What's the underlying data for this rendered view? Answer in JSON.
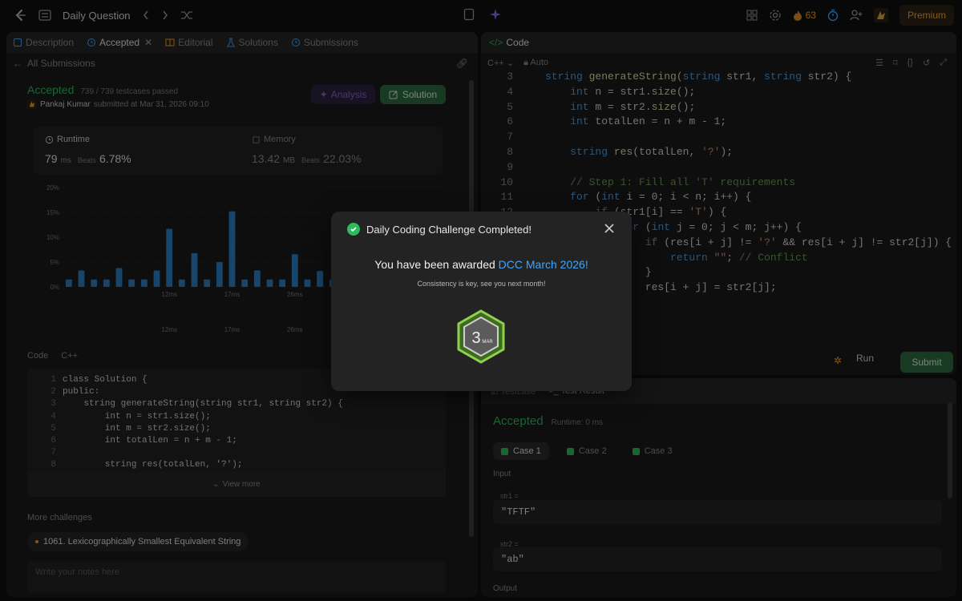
{
  "topbar": {
    "title": "Daily Question",
    "streak": "63",
    "premium": "Premium"
  },
  "left": {
    "tabs": [
      "Description",
      "Accepted",
      "Editorial",
      "Solutions",
      "Submissions"
    ],
    "back_label": "All Submissions",
    "status": "Accepted",
    "testcases": "739 / 739 testcases passed",
    "author": "Pankaj Kumar",
    "submitted_text": "submitted at Mar 31, 2026 09:10",
    "analysis_label": "Analysis",
    "solution_label": "Solution",
    "runtime": {
      "label": "Runtime",
      "value": "79",
      "unit": "ms",
      "beats_label": "Beats",
      "beats": "6.78%"
    },
    "memory": {
      "label": "Memory",
      "value": "13.42",
      "unit": "MB",
      "beats_label": "Beats",
      "beats": "22.03%"
    },
    "code_label": "Code",
    "lang": "C++",
    "code_lines": [
      "class Solution {",
      "public:",
      "    string generateString(string str1, string str2) {",
      "        int n = str1.size();",
      "        int m = str2.size();",
      "        int totalLen = n + m - 1;",
      "",
      "        string res(totalLen, '?');"
    ],
    "view_more": "View more",
    "more_challenges": "More challenges",
    "challenge_item": "1061. Lexicographically Smallest Equivalent String",
    "notes_placeholder": "Write your notes here"
  },
  "chart_data": {
    "type": "bar",
    "yticks": [
      "20%",
      "15%",
      "10%",
      "5%",
      "0%"
    ],
    "ylim": [
      0,
      20
    ],
    "xticks": [
      "12ms",
      "17ms",
      "26ms"
    ],
    "values": [
      1.5,
      3.3,
      1.5,
      1.5,
      3.8,
      1.5,
      1.5,
      3.3,
      11.7,
      1.5,
      6.8,
      1.5,
      5.0,
      15.2,
      1.5,
      3.3,
      1.5,
      1.5,
      6.6,
      1.5,
      3.2,
      1.5,
      1.5,
      3.3,
      1.5,
      1.5,
      1.5,
      1.5,
      1.5,
      1.5
    ],
    "highlight_index": 22,
    "mini_xticks": [
      "12ms",
      "17ms",
      "26ms"
    ]
  },
  "code": {
    "tab_label": "Code",
    "lang": "C++",
    "auto": "Auto",
    "start_line": 3,
    "lines": [
      [
        {
          "t": "string ",
          "c": "kw"
        },
        {
          "t": "generateString",
          "c": "fn"
        },
        {
          "t": "(",
          "c": ""
        },
        {
          "t": "string",
          "c": "kw"
        },
        {
          "t": " str1, ",
          "c": ""
        },
        {
          "t": "string",
          "c": "kw"
        },
        {
          "t": " str2) {",
          "c": ""
        }
      ],
      [
        {
          "t": "    int",
          "c": "kw"
        },
        {
          "t": " n = str1.",
          "c": ""
        },
        {
          "t": "size",
          "c": "fn"
        },
        {
          "t": "();",
          "c": ""
        }
      ],
      [
        {
          "t": "    int",
          "c": "kw"
        },
        {
          "t": " m = str2.",
          "c": ""
        },
        {
          "t": "size",
          "c": "fn"
        },
        {
          "t": "();",
          "c": ""
        }
      ],
      [
        {
          "t": "    int",
          "c": "kw"
        },
        {
          "t": " totalLen = n + m - 1;",
          "c": ""
        }
      ],
      [],
      [
        {
          "t": "    string ",
          "c": "kw"
        },
        {
          "t": "res",
          "c": "fn"
        },
        {
          "t": "(totalLen, ",
          "c": ""
        },
        {
          "t": "'?'",
          "c": "str"
        },
        {
          "t": ");",
          "c": ""
        }
      ],
      [],
      [
        {
          "t": "    // Step 1: Fill all 'T' requirements",
          "c": "cm"
        }
      ],
      [
        {
          "t": "    for",
          "c": "kw"
        },
        {
          "t": " (",
          "c": ""
        },
        {
          "t": "int",
          "c": "kw"
        },
        {
          "t": " i = 0; i < n; i++) {",
          "c": ""
        }
      ],
      [
        {
          "t": "        if",
          "c": "kw"
        },
        {
          "t": " (str1[i] == ",
          "c": ""
        },
        {
          "t": "'T'",
          "c": "str"
        },
        {
          "t": ") {",
          "c": ""
        }
      ],
      [
        {
          "t": "            for",
          "c": "kw"
        },
        {
          "t": " (",
          "c": ""
        },
        {
          "t": "int",
          "c": "kw"
        },
        {
          "t": " j = 0; j < m; j++) {",
          "c": ""
        }
      ],
      [
        {
          "t": "                if",
          "c": "kw"
        },
        {
          "t": " (res[i + j] != ",
          "c": ""
        },
        {
          "t": "'?'",
          "c": "str"
        },
        {
          "t": " && res[i + j] != str2[j]) {",
          "c": ""
        }
      ],
      [
        {
          "t": "                    return",
          "c": "kw"
        },
        {
          "t": " ",
          "c": ""
        },
        {
          "t": "\"\"",
          "c": "str"
        },
        {
          "t": "; ",
          "c": ""
        },
        {
          "t": "// Conflict",
          "c": "cm"
        }
      ],
      [
        {
          "t": "                }",
          "c": ""
        }
      ],
      [
        {
          "t": "                res[i + j] = str2[j];",
          "c": ""
        }
      ]
    ],
    "run": "Run",
    "submit": "Submit"
  },
  "result": {
    "tabs": [
      "Testcase",
      "Test Result"
    ],
    "status": "Accepted",
    "runtime": "Runtime: 0 ms",
    "cases": [
      "Case 1",
      "Case 2",
      "Case 3"
    ],
    "input_label": "Input",
    "var1": "str1 =",
    "val1": "\"TFTF\"",
    "var2": "str2 =",
    "val2": "\"ab\"",
    "output_label": "Output"
  },
  "modal": {
    "title": "Daily Coding Challenge Completed!",
    "msg_prefix": "You have been awarded",
    "msg_link": "DCC March 2026!",
    "sub": "Consistency is key, see you next month!",
    "badge_num": "3",
    "badge_month": "MAR"
  }
}
